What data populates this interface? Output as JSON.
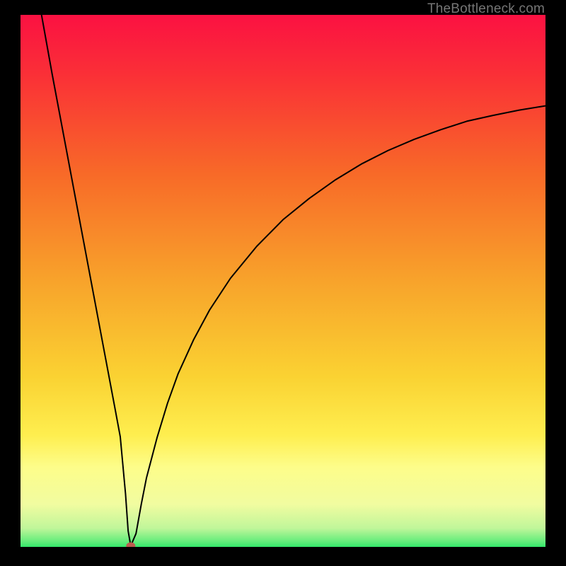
{
  "attribution": "TheBottleneck.com",
  "colors": {
    "gradient_top": "#fb1142",
    "gradient_mid1": "#f95f29",
    "gradient_mid2": "#fad733",
    "gradient_low": "#fdfd8a",
    "gradient_base": "#33e86a",
    "black_frame": "#000000",
    "curve": "#000000",
    "marker": "#bc5b4f"
  },
  "chart_data": {
    "type": "line",
    "title": "",
    "xlabel": "",
    "ylabel": "",
    "xlim": [
      0,
      100
    ],
    "ylim": [
      0,
      100
    ],
    "x": [
      4,
      6,
      8,
      10,
      12,
      14,
      16,
      18,
      19,
      20,
      20.5,
      21,
      22,
      23,
      24,
      26,
      28,
      30,
      33,
      36,
      40,
      45,
      50,
      55,
      60,
      65,
      70,
      75,
      80,
      85,
      90,
      95,
      100
    ],
    "values": [
      100,
      89,
      78.5,
      68,
      57.5,
      47,
      36.5,
      26,
      20.7,
      10,
      3,
      0.2,
      2.5,
      8,
      13,
      20.5,
      27,
      32.5,
      39,
      44.5,
      50.5,
      56.5,
      61.5,
      65.5,
      69,
      72,
      74.5,
      76.6,
      78.4,
      80,
      81.1,
      82.1,
      82.9
    ],
    "marker": {
      "x": 21,
      "y": 0.2
    },
    "notes": "V-shaped bottleneck curve with single minimum near x≈21. Values estimated from pixel positions; no axis ticks or labels visible."
  }
}
